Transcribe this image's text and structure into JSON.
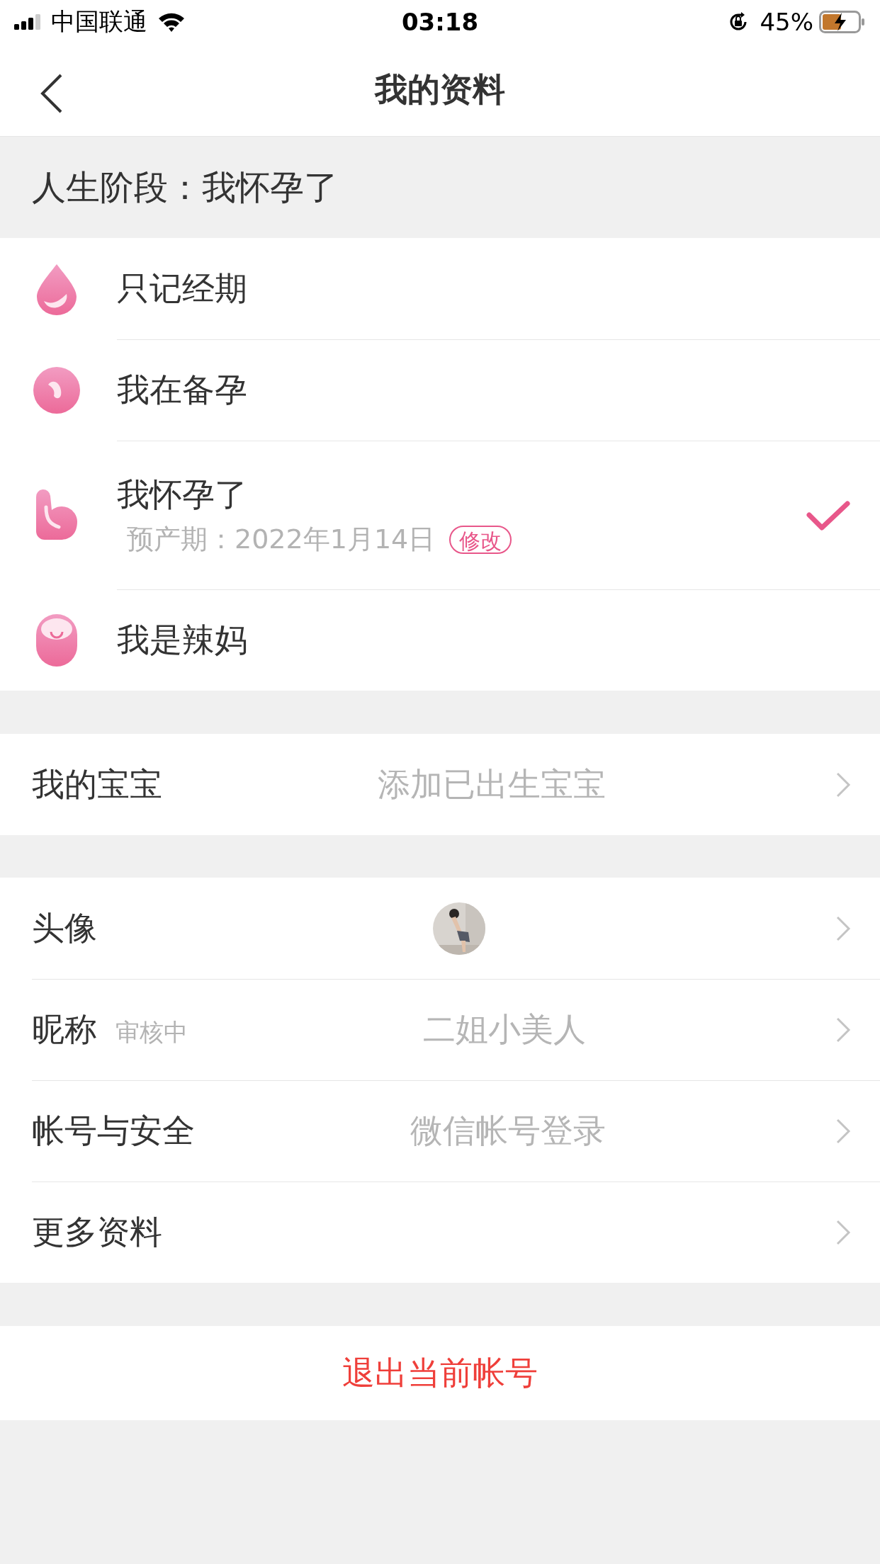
{
  "status_bar": {
    "carrier": "中国联通",
    "time": "03:18",
    "battery": "45%"
  },
  "nav": {
    "title": "我的资料"
  },
  "stage_header": "人生阶段：我怀孕了",
  "stages": [
    {
      "kind": "drop",
      "label": "只记经期",
      "selected": false
    },
    {
      "kind": "seed",
      "label": "我在备孕",
      "selected": false
    },
    {
      "kind": "bump",
      "label": "我怀孕了",
      "selected": true,
      "due": "预产期：2022年1月14日",
      "edit": "修改"
    },
    {
      "kind": "baby",
      "label": "我是辣妈",
      "selected": false
    }
  ],
  "baby": {
    "label": "我的宝宝",
    "value": "添加已出生宝宝"
  },
  "settings": [
    {
      "kind": "avatar",
      "label": "头像"
    },
    {
      "kind": "text",
      "label": "昵称",
      "note": "审核中",
      "value": "二姐小美人"
    },
    {
      "kind": "text",
      "label": "帐号与安全",
      "value": "微信帐号登录"
    },
    {
      "kind": "text",
      "label": "更多资料"
    }
  ],
  "logout": "退出当前帐号"
}
